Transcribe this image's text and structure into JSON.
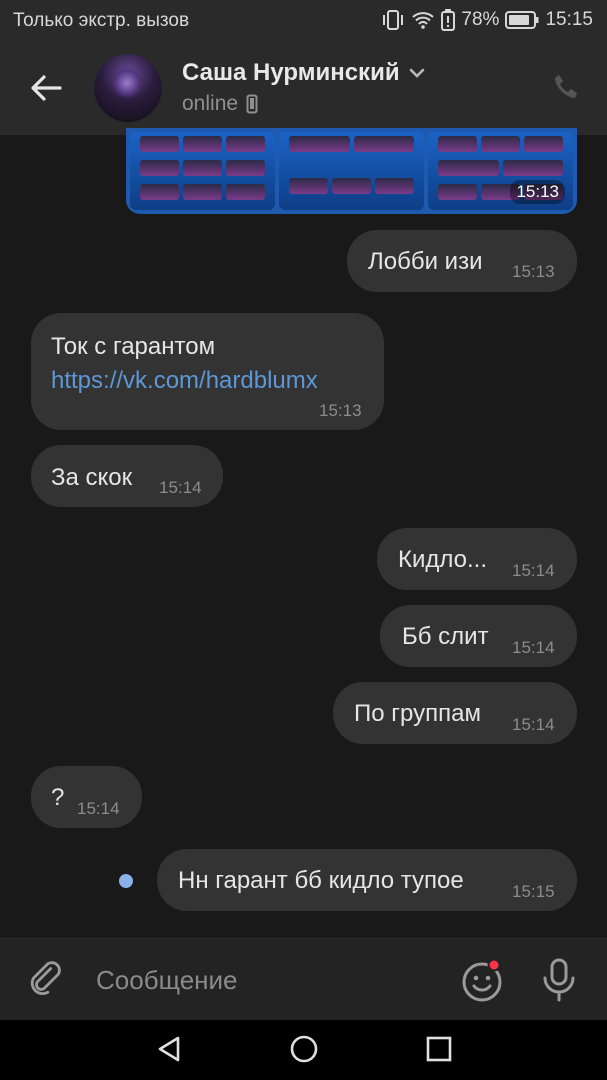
{
  "status_bar": {
    "carrier": "Только экстр. вызов",
    "battery": "78%",
    "time": "15:15"
  },
  "header": {
    "contact_name": "Саша Нурминский",
    "status": "online"
  },
  "media_preview": {
    "time": "15:13"
  },
  "messages": [
    {
      "direction": "out",
      "text": "Лобби изи",
      "time": "15:13"
    },
    {
      "direction": "in",
      "text": "Ток с гарантом",
      "link": "https://vk.com/hardblumx",
      "time": "15:13"
    },
    {
      "direction": "in",
      "text": "За скок",
      "time": "15:14"
    },
    {
      "direction": "out",
      "text": "Кидло...",
      "time": "15:14"
    },
    {
      "direction": "out",
      "text": "Бб слит",
      "time": "15:14"
    },
    {
      "direction": "out",
      "text": "По группам",
      "time": "15:14"
    },
    {
      "direction": "in",
      "text": "?",
      "time": "15:14"
    },
    {
      "direction": "out",
      "text": "Нн гарант бб кидло тупое",
      "time": "15:15",
      "unread": true
    }
  ],
  "composer": {
    "placeholder": "Сообщение"
  },
  "colors": {
    "background": "#191919",
    "bar": "#2a2a2a",
    "bubble": "#333334",
    "link": "#5d97d6",
    "unread_dot": "#8ab2e8",
    "emoji_badge": "#ff3347"
  }
}
